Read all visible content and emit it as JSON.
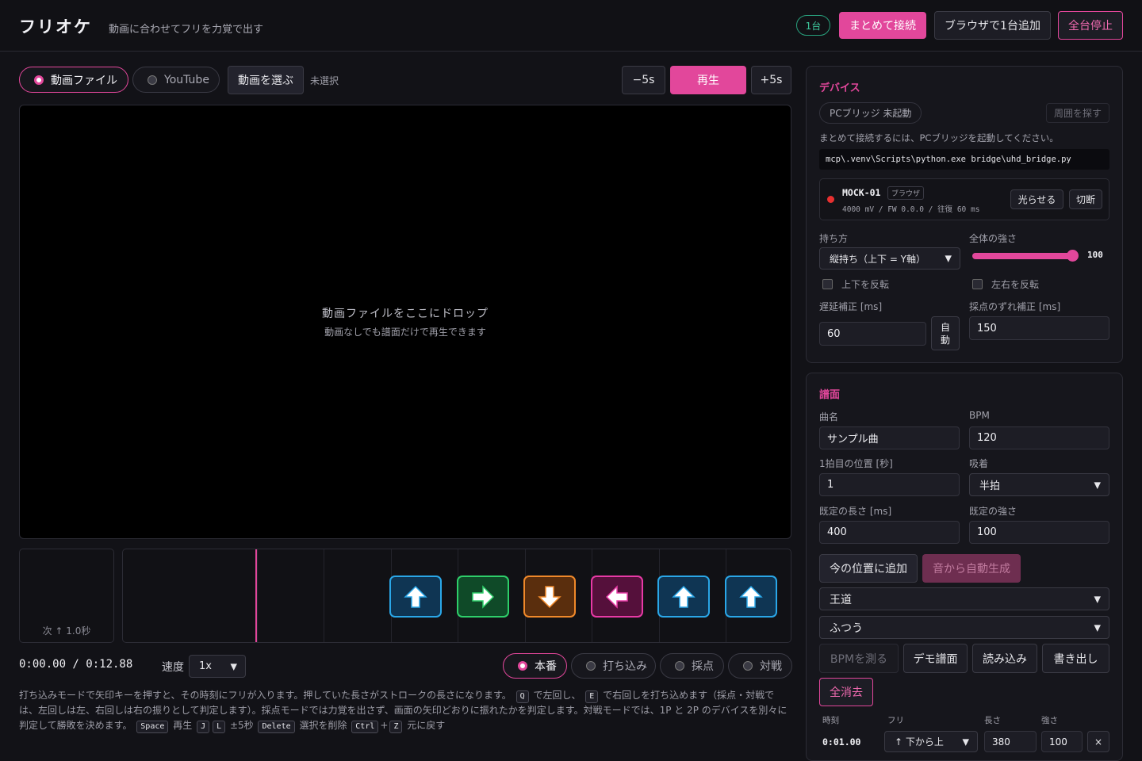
{
  "header": {
    "brand": "フリオケ",
    "tagline": "動画に合わせてフリを力覚で出す",
    "device_count": "1台",
    "connect_all": "まとめて接続",
    "add_browser_device": "ブラウザで1台追加",
    "stop_all": "全台停止"
  },
  "source": {
    "tab_file": "動画ファイル",
    "tab_youtube": "YouTube",
    "choose_video": "動画を選ぶ",
    "selected_file": "未選択"
  },
  "transport": {
    "back5": "−5s",
    "play": "再生",
    "fwd5": "+5s"
  },
  "video": {
    "drop_title": "動画ファイルをここにドロップ",
    "drop_sub": "動画なしでも譜面だけで再生できます"
  },
  "next_note": "次 ↑ 1.0秒",
  "lane": {
    "notes": [
      {
        "dir": "up",
        "color": "#2aa7e8",
        "bg": "#0f3553"
      },
      {
        "dir": "right",
        "color": "#2ecf6a",
        "bg": "#0f4a28"
      },
      {
        "dir": "down",
        "color": "#f0892a",
        "bg": "#5a2e0d"
      },
      {
        "dir": "left",
        "color": "#e83aa6",
        "bg": "#55103b"
      },
      {
        "dir": "up",
        "color": "#2aa7e8",
        "bg": "#0f3553"
      },
      {
        "dir": "up",
        "color": "#2aa7e8",
        "bg": "#0f3553"
      }
    ]
  },
  "playback": {
    "time": "0:00.00 / 0:12.88",
    "speed_label": "速度",
    "speed_value": "1x"
  },
  "modes": [
    "本番",
    "打ち込み",
    "採点",
    "対戦"
  ],
  "help": {
    "p1": "打ち込みモードで矢印キーを押すと、その時刻にフリが入ります。押していた長さがストロークの長さになります。",
    "k_q": "Q",
    "p2": "で左回し、",
    "k_e": "E",
    "p3": "で右回しを打ち込めます（採点・対戦では、左回しは左、右回しは右の振りとして判定します）。採点モードでは力覚を出さず、画面の矢印どおりに振れたかを判定します。対戦モードでは、1P と 2P のデバイスを別々に判定して勝敗を決めます。",
    "k_space": "Space",
    "p4": "再生",
    "k_j": "J",
    "k_l": "L",
    "p5": "±5秒",
    "k_delete": "Delete",
    "p6": "選択を削除",
    "k_ctrl": "Ctrl",
    "p7": "+",
    "k_z": "Z",
    "p8": "元に戻す"
  },
  "device_panel": {
    "title": "デバイス",
    "bridge_status": "PCブリッジ 未起動",
    "scan": "周囲を探す",
    "bridge_note": "まとめて接続するには、PCブリッジを起動してください。",
    "bridge_cmd": "mcp\\.venv\\Scripts\\python.exe bridge\\uhd_bridge.py",
    "device_name": "MOCK-01",
    "device_tag": "ブラウザ",
    "device_info": "4000 mV / FW 0.0.0 / 往復 60 ms",
    "light": "光らせる",
    "disconnect": "切断",
    "grip_label": "持ち方",
    "grip_value": "縦持ち（上下 = Y軸）",
    "strength_label": "全体の強さ",
    "strength_value": "100",
    "strength_fraction": 1.0,
    "flip_ud": "上下を反転",
    "flip_lr": "左右を反転",
    "latency_label": "遅延補正 [ms]",
    "latency_value": "60",
    "auto": "自動",
    "score_offset_label": "採点のずれ補正 [ms]",
    "score_offset_value": "150"
  },
  "chart_panel": {
    "title": "譜面",
    "song_label": "曲名",
    "song_value": "サンプル曲",
    "bpm_label": "BPM",
    "bpm_value": "120",
    "beat1_label": "1拍目の位置 [秒]",
    "beat1_value": "1",
    "snap_label": "吸着",
    "snap_value": "半拍",
    "len_label": "既定の長さ [ms]",
    "len_value": "400",
    "str_label": "既定の強さ",
    "str_value": "100",
    "add_now": "今の位置に追加",
    "auto_gen": "音から自動生成",
    "style_value": "王道",
    "difficulty_value": "ふつう",
    "measure_bpm": "BPMを測る",
    "demo": "デモ譜面",
    "load": "読み込み",
    "export": "書き出し",
    "clear_all": "全消去",
    "cols": [
      "時刻",
      "フリ",
      "長さ",
      "強さ"
    ],
    "row": {
      "time": "0:01.00",
      "furi": "↑ 下から上",
      "len": "380",
      "str": "100",
      "del": "×"
    }
  }
}
